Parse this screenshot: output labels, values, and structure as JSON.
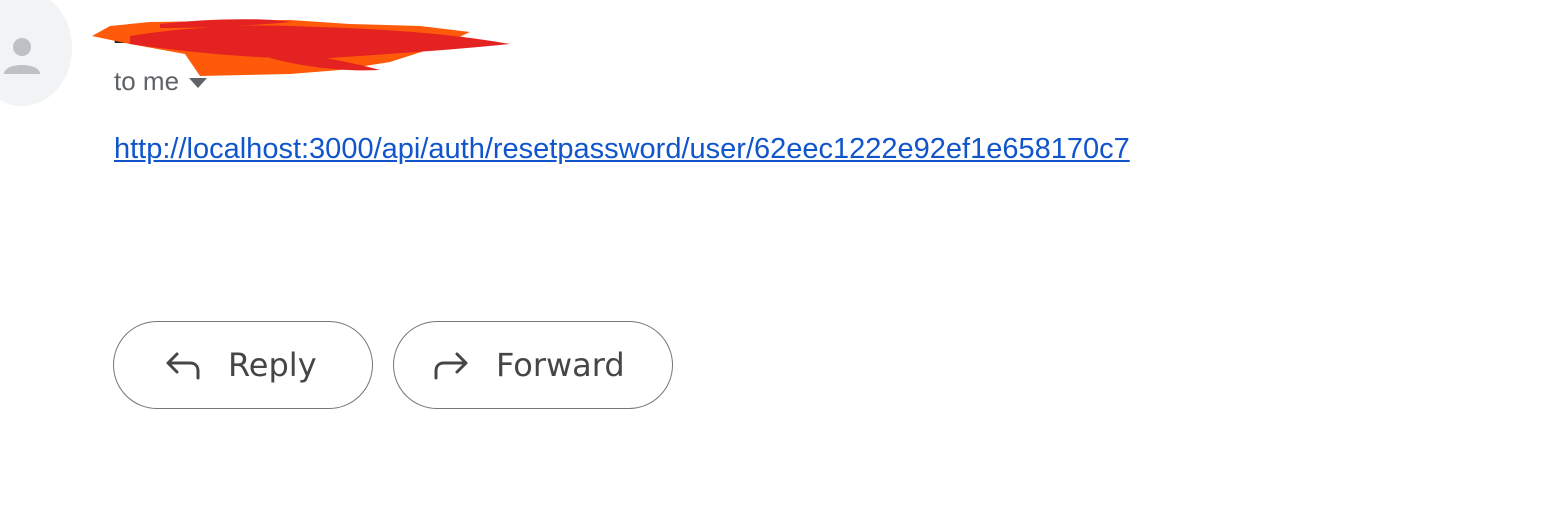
{
  "message": {
    "sender_name": "Z",
    "recipients_label": "to me",
    "body_link": "http://localhost:3000/api/auth/resetpassword/user/62eec1222e92ef1e658170c7"
  },
  "actions": {
    "reply_label": "Reply",
    "forward_label": "Forward"
  },
  "icons": {
    "avatar": "person-icon",
    "recipients_toggle": "caret-down-icon",
    "reply": "reply-arrow-icon",
    "forward": "forward-arrow-icon"
  },
  "colors": {
    "link": "#1155cc",
    "secondary_text": "#5f6368",
    "button_border": "#747775",
    "redaction_red": "#e52222",
    "redaction_orange": "#ff5a0a"
  }
}
